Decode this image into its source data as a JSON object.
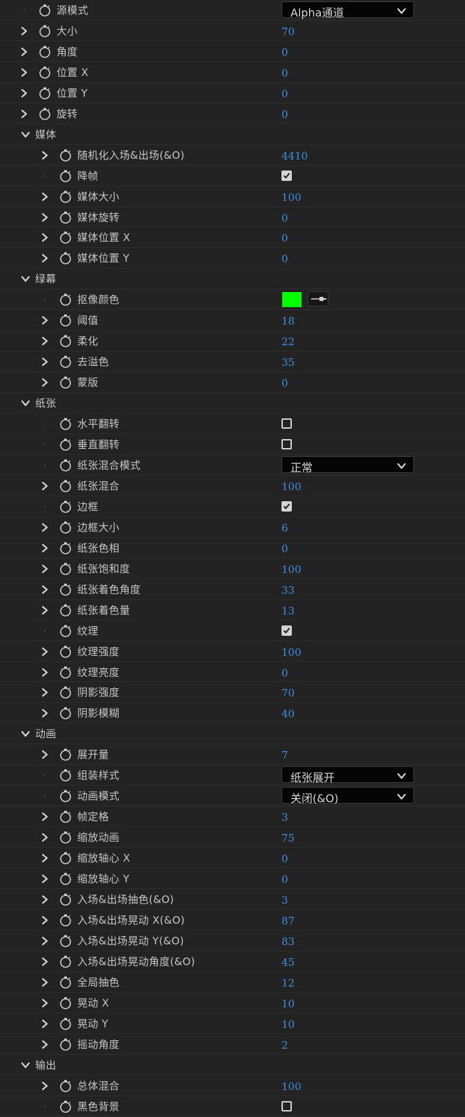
{
  "rows": [
    {
      "label": "源模式",
      "type": "dropdown",
      "value": "Alpha通道",
      "level": 1,
      "twirl": false,
      "stopwatch": true
    },
    {
      "label": "大小",
      "type": "number",
      "value": "70",
      "level": 1,
      "twirl": true,
      "stopwatch": true
    },
    {
      "label": "角度",
      "type": "number",
      "value": "0",
      "level": 1,
      "twirl": true,
      "stopwatch": true
    },
    {
      "label": "位置 X",
      "type": "number",
      "value": "0",
      "level": 1,
      "twirl": true,
      "stopwatch": true
    },
    {
      "label": "位置 Y",
      "type": "number",
      "value": "0",
      "level": 1,
      "twirl": true,
      "stopwatch": true
    },
    {
      "label": "旋转",
      "type": "number",
      "value": "0",
      "level": 1,
      "twirl": true,
      "stopwatch": true
    },
    {
      "label": "媒体",
      "type": "group",
      "level": 0
    },
    {
      "label": "随机化入场&出场(&O)",
      "type": "number",
      "value": "4410",
      "level": 2,
      "twirl": true,
      "stopwatch": true
    },
    {
      "label": "降帧",
      "type": "checkbox",
      "checked": true,
      "level": 2,
      "twirl": false,
      "stopwatch": true
    },
    {
      "label": "媒体大小",
      "type": "number",
      "value": "100",
      "level": 2,
      "twirl": true,
      "stopwatch": true
    },
    {
      "label": "媒体旋转",
      "type": "number",
      "value": "0",
      "level": 2,
      "twirl": true,
      "stopwatch": true
    },
    {
      "label": "媒体位置 X",
      "type": "number",
      "value": "0",
      "level": 2,
      "twirl": true,
      "stopwatch": true
    },
    {
      "label": "媒体位置 Y",
      "type": "number",
      "value": "0",
      "level": 2,
      "twirl": true,
      "stopwatch": true
    },
    {
      "label": "绿幕",
      "type": "group",
      "level": 0
    },
    {
      "label": "抠像颜色",
      "type": "color",
      "color": "#00ff00",
      "level": 2,
      "twirl": false,
      "stopwatch": true
    },
    {
      "label": "阈值",
      "type": "number",
      "value": "18",
      "level": 2,
      "twirl": true,
      "stopwatch": true
    },
    {
      "label": "柔化",
      "type": "number",
      "value": "22",
      "level": 2,
      "twirl": true,
      "stopwatch": true
    },
    {
      "label": "去溢色",
      "type": "number",
      "value": "35",
      "level": 2,
      "twirl": true,
      "stopwatch": true
    },
    {
      "label": "蒙版",
      "type": "number",
      "value": "0",
      "level": 2,
      "twirl": true,
      "stopwatch": true
    },
    {
      "label": "纸张",
      "type": "group",
      "level": 0
    },
    {
      "label": "水平翻转",
      "type": "checkbox",
      "checked": false,
      "level": 2,
      "twirl": false,
      "stopwatch": true
    },
    {
      "label": "垂直翻转",
      "type": "checkbox",
      "checked": false,
      "level": 2,
      "twirl": false,
      "stopwatch": true
    },
    {
      "label": "纸张混合模式",
      "type": "dropdown",
      "value": "正常",
      "level": 2,
      "twirl": false,
      "stopwatch": true
    },
    {
      "label": "纸张混合",
      "type": "number",
      "value": "100",
      "level": 2,
      "twirl": true,
      "stopwatch": true
    },
    {
      "label": "边框",
      "type": "checkbox",
      "checked": true,
      "level": 2,
      "twirl": false,
      "stopwatch": true
    },
    {
      "label": "边框大小",
      "type": "number",
      "value": "6",
      "level": 2,
      "twirl": true,
      "stopwatch": true
    },
    {
      "label": "纸张色相",
      "type": "number",
      "value": "0",
      "level": 2,
      "twirl": true,
      "stopwatch": true
    },
    {
      "label": "纸张饱和度",
      "type": "number",
      "value": "100",
      "level": 2,
      "twirl": true,
      "stopwatch": true
    },
    {
      "label": "纸张着色角度",
      "type": "number",
      "value": "33",
      "level": 2,
      "twirl": true,
      "stopwatch": true
    },
    {
      "label": "纸张着色量",
      "type": "number",
      "value": "13",
      "level": 2,
      "twirl": true,
      "stopwatch": true
    },
    {
      "label": "纹理",
      "type": "checkbox",
      "checked": true,
      "level": 2,
      "twirl": false,
      "stopwatch": true
    },
    {
      "label": "纹理强度",
      "type": "number",
      "value": "100",
      "level": 2,
      "twirl": true,
      "stopwatch": true
    },
    {
      "label": "纹理亮度",
      "type": "number",
      "value": "0",
      "level": 2,
      "twirl": true,
      "stopwatch": true
    },
    {
      "label": "阴影强度",
      "type": "number",
      "value": "70",
      "level": 2,
      "twirl": true,
      "stopwatch": true
    },
    {
      "label": "阴影模糊",
      "type": "number",
      "value": "40",
      "level": 2,
      "twirl": true,
      "stopwatch": true
    },
    {
      "label": "动画",
      "type": "group",
      "level": 0
    },
    {
      "label": "展开量",
      "type": "number",
      "value": "7",
      "level": 2,
      "twirl": true,
      "stopwatch": true
    },
    {
      "label": "组装样式",
      "type": "dropdown",
      "value": "纸张展开",
      "level": 2,
      "twirl": false,
      "stopwatch": true
    },
    {
      "label": "动画模式",
      "type": "dropdown",
      "value": "关闭(&O)",
      "level": 2,
      "twirl": false,
      "stopwatch": true
    },
    {
      "label": "帧定格",
      "type": "number",
      "value": "3",
      "level": 2,
      "twirl": true,
      "stopwatch": true
    },
    {
      "label": "缩放动画",
      "type": "number",
      "value": "75",
      "level": 2,
      "twirl": true,
      "stopwatch": true
    },
    {
      "label": "缩放轴心 X",
      "type": "number",
      "value": "0",
      "level": 2,
      "twirl": true,
      "stopwatch": true
    },
    {
      "label": "缩放轴心 Y",
      "type": "number",
      "value": "0",
      "level": 2,
      "twirl": true,
      "stopwatch": true
    },
    {
      "label": "入场&出场抽色(&O)",
      "type": "number",
      "value": "3",
      "level": 2,
      "twirl": true,
      "stopwatch": true
    },
    {
      "label": "入场&出场晃动 X(&O)",
      "type": "number",
      "value": "87",
      "level": 2,
      "twirl": true,
      "stopwatch": true
    },
    {
      "label": "入场&出场晃动 Y(&O)",
      "type": "number",
      "value": "83",
      "level": 2,
      "twirl": true,
      "stopwatch": true
    },
    {
      "label": "入场&出场晃动角度(&O)",
      "type": "number",
      "value": "45",
      "level": 2,
      "twirl": true,
      "stopwatch": true
    },
    {
      "label": "全局抽色",
      "type": "number",
      "value": "12",
      "level": 2,
      "twirl": true,
      "stopwatch": true
    },
    {
      "label": "晃动 X",
      "type": "number",
      "value": "10",
      "level": 2,
      "twirl": true,
      "stopwatch": true
    },
    {
      "label": "晃动 Y",
      "type": "number",
      "value": "10",
      "level": 2,
      "twirl": true,
      "stopwatch": true
    },
    {
      "label": "摇动角度",
      "type": "number",
      "value": "2",
      "level": 2,
      "twirl": true,
      "stopwatch": true
    },
    {
      "label": "输出",
      "type": "group",
      "level": 0
    },
    {
      "label": "总体混合",
      "type": "number",
      "value": "100",
      "level": 2,
      "twirl": true,
      "stopwatch": true
    },
    {
      "label": "黑色背景",
      "type": "checkbox",
      "checked": false,
      "level": 2,
      "twirl": false,
      "stopwatch": true
    }
  ],
  "colors": {
    "background": "#232323",
    "value_blue": "#3f8fe3",
    "label": "#c6c6c6"
  },
  "icons": {
    "twirl_closed": "chevron-right-icon",
    "twirl_open": "chevron-down-icon",
    "stopwatch": "stopwatch-icon",
    "eyedropper": "eyedropper-icon"
  }
}
